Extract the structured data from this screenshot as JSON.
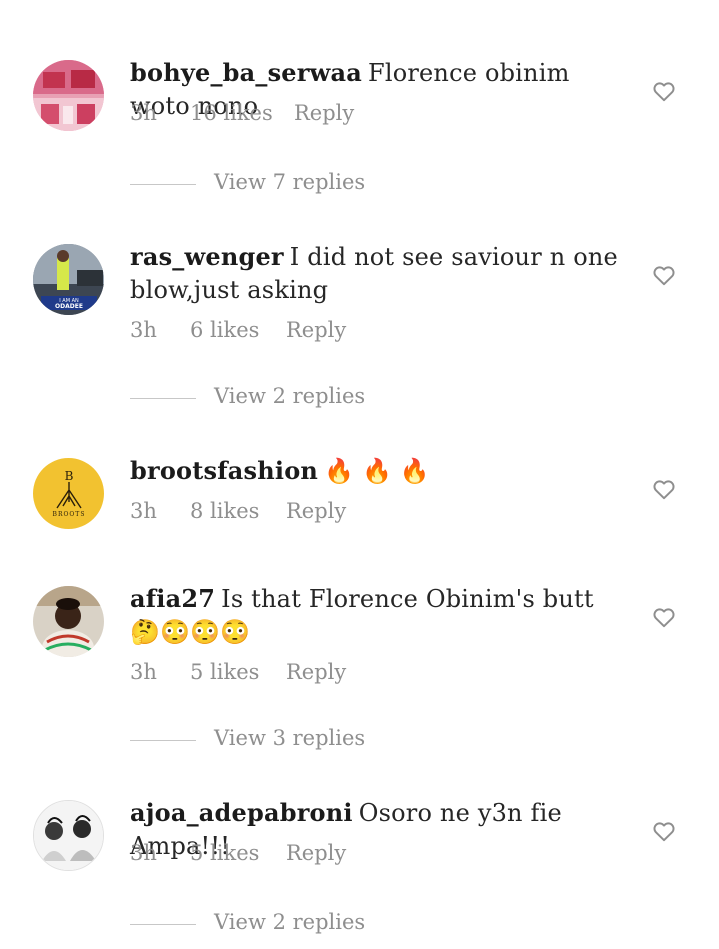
{
  "comments": [
    {
      "username": "bohye_ba_serwaa",
      "text": "Florence obinim woto nono",
      "time": "3h",
      "likes": "16 likes",
      "reply": "Reply",
      "view_replies": "View 7 replies"
    },
    {
      "username": "ras_wenger",
      "text": "I did not see saviour n one blow,just asking",
      "time": "3h",
      "likes": "6 likes",
      "reply": "Reply",
      "view_replies": "View 2 replies"
    },
    {
      "username": "brootsfashion",
      "text": "🔥 🔥 🔥",
      "time": "3h",
      "likes": "8 likes",
      "reply": "Reply"
    },
    {
      "username": "afia27",
      "text": "Is that Florence Obinim's butt 🤔😳😳😳",
      "time": "3h",
      "likes": "5 likes",
      "reply": "Reply",
      "view_replies": "View 3 replies"
    },
    {
      "username": "ajoa_adepabroni",
      "text": "Osoro ne y3n fie Ampa!!!",
      "time": "3h",
      "likes": "5 likes",
      "reply": "Reply",
      "view_replies": "View 2 replies"
    }
  ],
  "avatars": {
    "broots_text": "BROOTS",
    "ras_badge_text": "ODADEE"
  },
  "icons": {
    "like": "heart-outline-icon"
  },
  "colors": {
    "text": "#262626",
    "muted": "#8e8e8e",
    "divider": "#c7c7c7",
    "broots_bg": "#f2c230"
  }
}
